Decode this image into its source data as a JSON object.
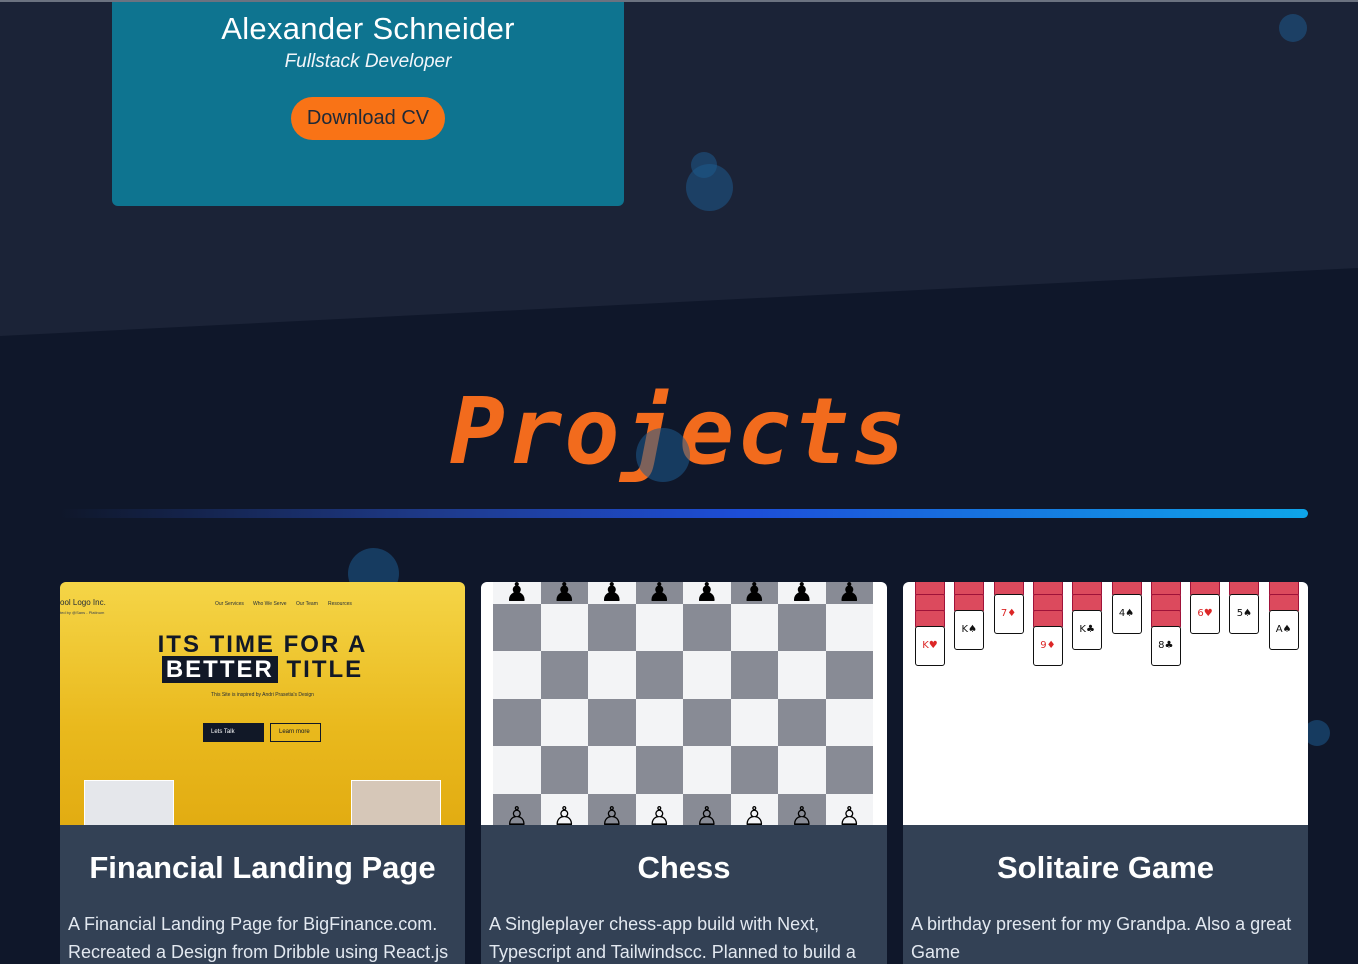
{
  "profile": {
    "name": "Alexander Schneider",
    "role": "Fullstack Developer",
    "cv_button": "Download CV"
  },
  "projects": {
    "title": "Projects",
    "cards": [
      {
        "title": "Financial Landing Page",
        "description": "A Financial Landing Page for BigFinance.com. Recreated a Design from Dribble using React.js",
        "thumbnail": {
          "logo": "ool Logo Inc.",
          "logo_sub": "ted by @Sans - Platinum",
          "nav": [
            "Our Services",
            "Who We Serve",
            "Our Team",
            "Resources"
          ],
          "headline_line1": "ITS TIME FOR A",
          "headline_highlight": "BETTER",
          "headline_rest": "TITLE",
          "tagline": "This Site is inspired by Andri Prasetia's Design",
          "primary_btn": "Lets Talk",
          "secondary_btn": "Learn more"
        }
      },
      {
        "title": "Chess",
        "description": "A Singleplayer chess-app build with Next, Typescript and Tailwindscc. Planned to build a"
      },
      {
        "title": "Solitaire Game",
        "description": "A birthday present for my Grandpa. Also a great Game"
      }
    ]
  },
  "colors": {
    "background": "#0f172a",
    "top_section": "#1b2337",
    "profile_card": "#0e7490",
    "accent_orange": "#f97316",
    "card_bg": "#334155"
  }
}
